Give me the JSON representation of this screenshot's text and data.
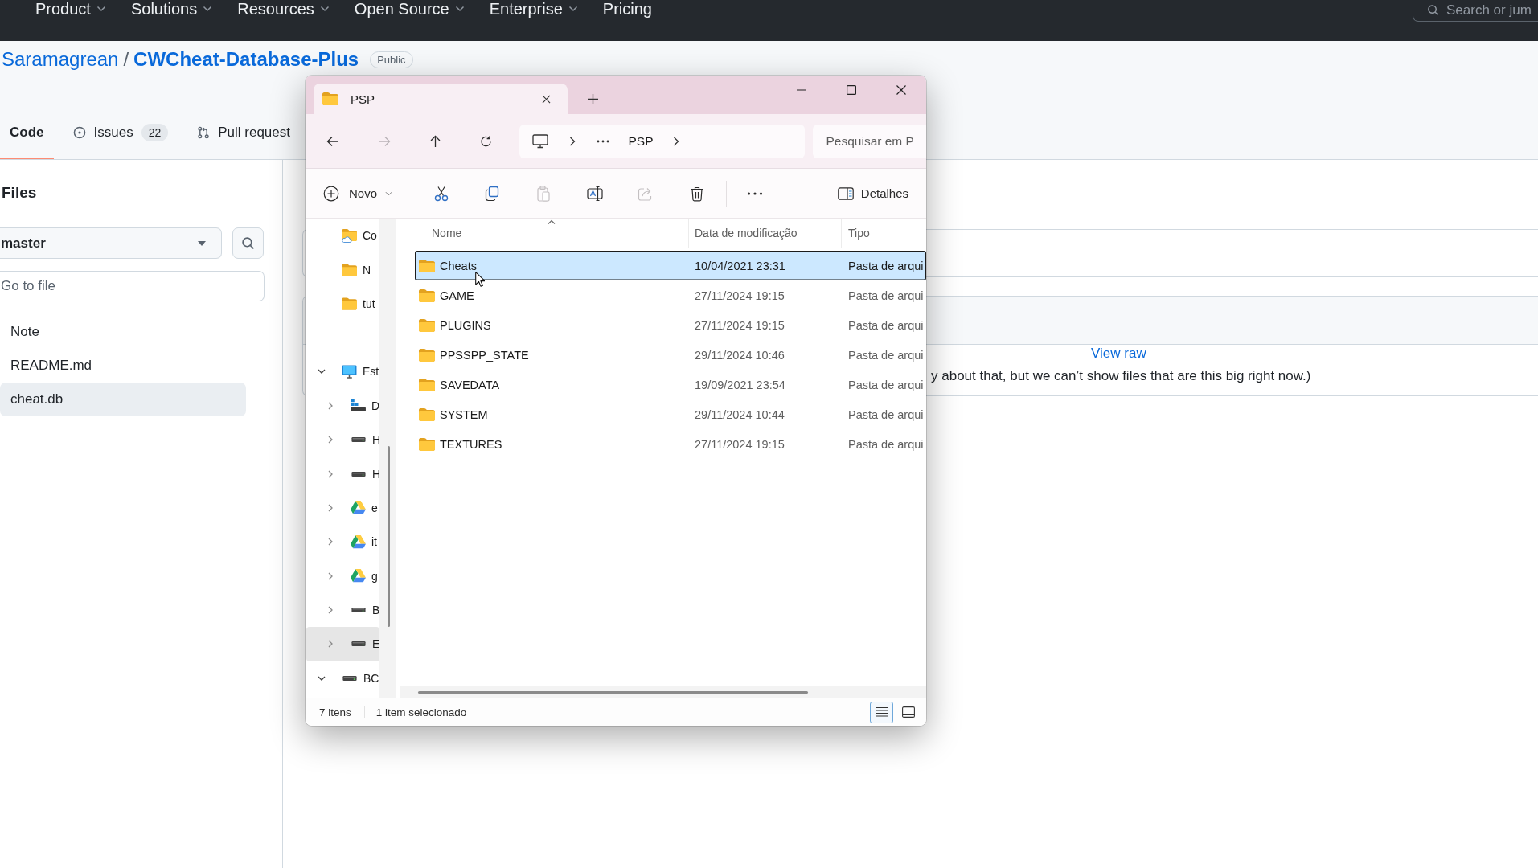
{
  "github": {
    "top_nav": {
      "items": [
        {
          "label": "Product",
          "has_menu": true
        },
        {
          "label": "Solutions",
          "has_menu": true
        },
        {
          "label": "Resources",
          "has_menu": true
        },
        {
          "label": "Open Source",
          "has_menu": true
        },
        {
          "label": "Enterprise",
          "has_menu": true
        },
        {
          "label": "Pricing",
          "has_menu": false
        }
      ],
      "search": {
        "placeholder": "Search or jum"
      }
    },
    "repo": {
      "owner": "Saramagrean",
      "separator": "/",
      "name": "CWCheat-Database-Plus",
      "visibility": "Public"
    },
    "repo_tabs": [
      {
        "kind": "code",
        "label": "Code",
        "selected": true
      },
      {
        "kind": "issues",
        "label": "Issues",
        "count": "22",
        "selected": false
      },
      {
        "kind": "pulls",
        "label": "Pull request",
        "selected": false
      }
    ],
    "file_sidebar": {
      "title": "Files",
      "branch": "master",
      "go_to_file": {
        "placeholder": "Go to file"
      },
      "files": [
        {
          "name": "Note",
          "selected": false
        },
        {
          "name": "README.md",
          "selected": false
        },
        {
          "name": "cheat.db",
          "selected": true
        }
      ]
    },
    "file_view": {
      "view_raw": "View raw",
      "message": "y about that, but we can’t show files that are this big right now.)"
    }
  },
  "explorer": {
    "tabs": [
      {
        "label": "PSP",
        "selected": true
      }
    ],
    "nav_buttons": [
      {
        "kind": "back",
        "disabled": false
      },
      {
        "kind": "forward",
        "disabled": true
      },
      {
        "kind": "up",
        "disabled": false
      },
      {
        "kind": "refresh",
        "disabled": false
      }
    ],
    "address": {
      "path": [
        "PSP"
      ]
    },
    "search": {
      "placeholder": "Pesquisar em P"
    },
    "commands": [
      {
        "kind": "new",
        "label": "Novo",
        "disabled": false
      },
      {
        "kind": "separator"
      },
      {
        "kind": "cut",
        "disabled": false
      },
      {
        "kind": "copy",
        "disabled": false
      },
      {
        "kind": "paste",
        "disabled": true
      },
      {
        "kind": "rename",
        "disabled": false
      },
      {
        "kind": "share",
        "disabled": true
      },
      {
        "kind": "delete",
        "disabled": false
      },
      {
        "kind": "separator"
      },
      {
        "kind": "more",
        "disabled": false
      },
      {
        "kind": "details",
        "label": "Detalhes",
        "disabled": false
      }
    ],
    "nav_pane": {
      "quick_access": [
        {
          "label": "Co",
          "kind": "cloud-folder",
          "selected": false
        },
        {
          "label": "N",
          "kind": "folder",
          "selected": false
        },
        {
          "label": "tut",
          "kind": "folder",
          "selected": false
        }
      ],
      "tree": [
        {
          "label": "Est",
          "kind": "computer",
          "expanded": true,
          "selected": false,
          "children": [
            {
              "label": "D",
              "kind": "network-drive",
              "expanded": false,
              "selected": false
            },
            {
              "label": "H",
              "kind": "drive",
              "expanded": false,
              "selected": false
            },
            {
              "label": "H",
              "kind": "drive",
              "expanded": false,
              "selected": false
            },
            {
              "label": "e",
              "kind": "cloud-drive",
              "expanded": false,
              "selected": false
            },
            {
              "label": "it",
              "kind": "cloud-drive",
              "expanded": false,
              "selected": false
            },
            {
              "label": "g",
              "kind": "cloud-drive",
              "expanded": false,
              "selected": false
            },
            {
              "label": "B",
              "kind": "drive",
              "expanded": false,
              "selected": false
            },
            {
              "label": "E",
              "kind": "drive",
              "expanded": false,
              "selected": true
            }
          ]
        },
        {
          "label": "BC",
          "kind": "drive",
          "expanded": true,
          "selected": false
        }
      ]
    },
    "columns": [
      {
        "label": "Nome",
        "sorted": true
      },
      {
        "label": "Data de modificação",
        "sorted": false
      },
      {
        "label": "Tipo",
        "sorted": false
      }
    ],
    "rows": [
      {
        "name": "Cheats",
        "modified": "10/04/2021 23:31",
        "type": "Pasta de arqui",
        "selected": true
      },
      {
        "name": "GAME",
        "modified": "27/11/2024 19:15",
        "type": "Pasta de arqui",
        "selected": false
      },
      {
        "name": "PLUGINS",
        "modified": "27/11/2024 19:15",
        "type": "Pasta de arqui",
        "selected": false
      },
      {
        "name": "PPSSPP_STATE",
        "modified": "29/11/2024 10:46",
        "type": "Pasta de arqui",
        "selected": false
      },
      {
        "name": "SAVEDATA",
        "modified": "19/09/2021 23:54",
        "type": "Pasta de arqui",
        "selected": false
      },
      {
        "name": "SYSTEM",
        "modified": "29/11/2024 10:44",
        "type": "Pasta de arqui",
        "selected": false
      },
      {
        "name": "TEXTURES",
        "modified": "27/11/2024 19:15",
        "type": "Pasta de arqui",
        "selected": false
      }
    ],
    "status": {
      "item_count": "7 itens",
      "selection": "1 item selecionado"
    },
    "view_modes": [
      {
        "kind": "details",
        "selected": true
      },
      {
        "kind": "tiles",
        "selected": false
      }
    ]
  }
}
